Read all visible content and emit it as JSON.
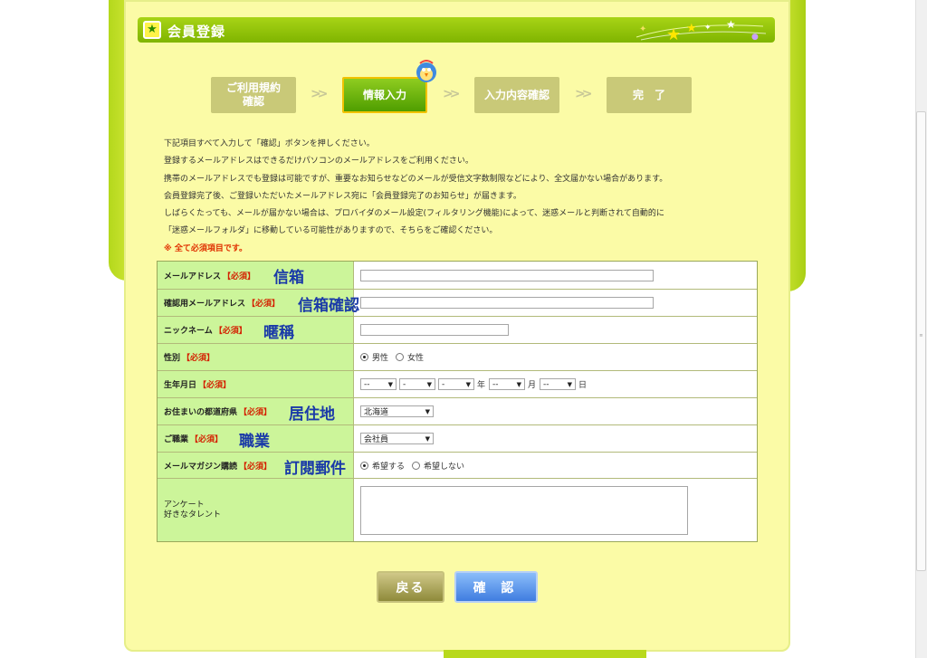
{
  "header": {
    "title": "会員登録",
    "icon": "star-icon"
  },
  "steps": [
    {
      "label_line1": "ご利用規約",
      "label_line2": "確認",
      "active": false
    },
    {
      "label_line1": "情報入力",
      "label_line2": "",
      "active": true
    },
    {
      "label_line1": "入力内容確認",
      "label_line2": "",
      "active": false
    },
    {
      "label_line1": "完　了",
      "label_line2": "",
      "active": false
    }
  ],
  "step_separator": ">>",
  "info": {
    "lines": [
      "下記項目すべて入力して「確認」ボタンを押しください。",
      "登録するメールアドレスはできるだけパソコンのメールアドレスをご利用ください。",
      "携帯のメールアドレスでも登録は可能ですが、重要なお知らせなどのメールが受信文字数制限などにより、全文届かない場合があります。",
      "会員登録完了後、ご登録いただいたメールアドレス宛に「会員登録完了のお知らせ」が届きます。",
      "しばらくたっても、メールが届かない場合は、プロバイダのメール設定(フィルタリング機能)によって、迷惑メールと判断されて自動的に",
      "「迷惑メールフォルダ」に移動している可能性がありますので、そちらをご確認ください。"
    ],
    "required_note": "※ 全て必須項目です。"
  },
  "form": {
    "required_tag": "【必須】",
    "email": {
      "label": "メールアドレス",
      "annotation": "信箱",
      "value": ""
    },
    "email_confirm": {
      "label": "確認用メールアドレス",
      "annotation": "信箱確認",
      "value": ""
    },
    "nickname": {
      "label": "ニックネーム",
      "annotation": "暱稱",
      "value": ""
    },
    "gender": {
      "label": "性別",
      "options": [
        "男性",
        "女性"
      ],
      "selected": "男性"
    },
    "birthday": {
      "label": "生年月日",
      "year_sel": "--",
      "month_sel": "--",
      "day_sel": "--",
      "extra_sel": "-",
      "extra_sel2": "-",
      "year_unit": "年",
      "month_unit": "月",
      "day_unit": "日"
    },
    "prefecture": {
      "label": "お住まいの都道府県",
      "annotation": "居住地",
      "selected": "北海道"
    },
    "occupation": {
      "label": "ご職業",
      "annotation": "職業",
      "selected": "会社員"
    },
    "magazine": {
      "label": "メールマガジン購読",
      "annotation": "訂閱郵件",
      "options": [
        "希望する",
        "希望しない"
      ],
      "selected": "希望する"
    },
    "survey": {
      "label_line1": "アンケート",
      "label_line2": "好きなタレント",
      "value": ""
    }
  },
  "buttons": {
    "back": "戻る",
    "confirm": "確 認"
  },
  "colors": {
    "accent_green": "#7fb400",
    "panel_yellow": "#fbfba6",
    "label_green": "#ccf59a",
    "required_red": "#d42000",
    "confirm_blue": "#3f7de0"
  }
}
